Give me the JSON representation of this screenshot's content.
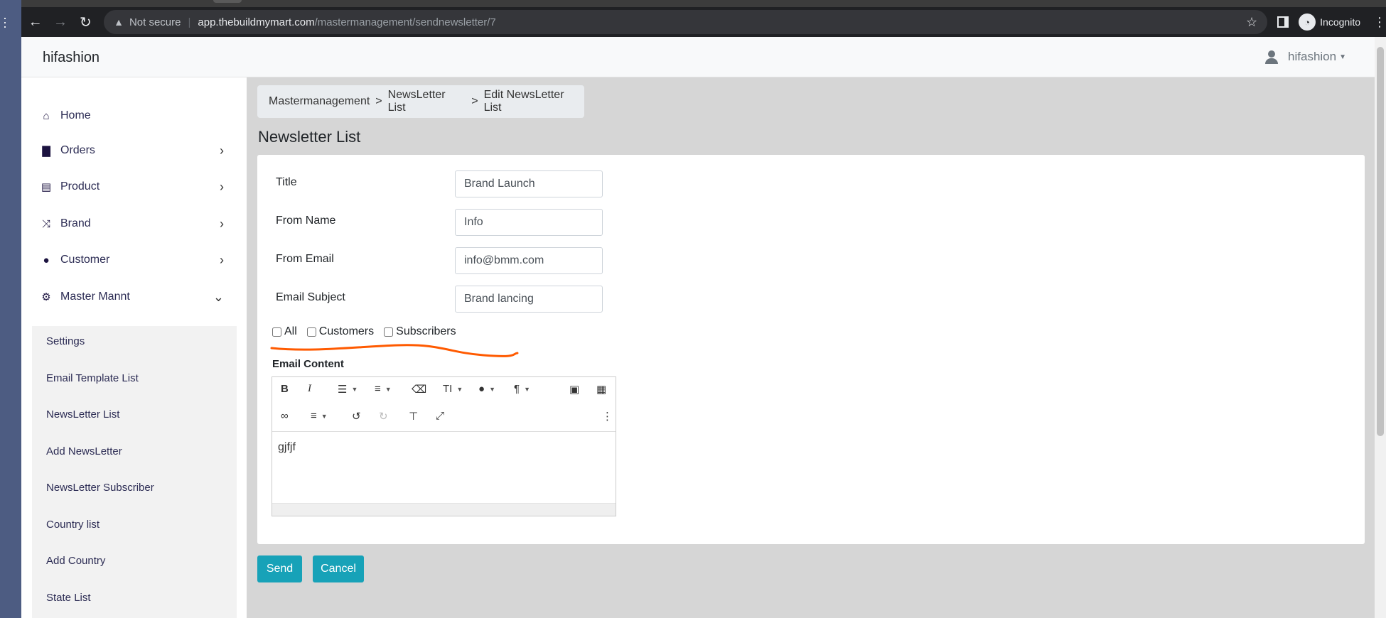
{
  "browser": {
    "security_label": "Not secure",
    "url_host": "app.thebuildmymart.com",
    "url_path": "/mastermanagement/sendnewsletter/7",
    "profile_label": "Incognito"
  },
  "navbar": {
    "brand": "hifashion",
    "user": "hifashion"
  },
  "sidebar": {
    "items": [
      {
        "label": "Home"
      },
      {
        "label": "Orders"
      },
      {
        "label": "Product"
      },
      {
        "label": "Brand"
      },
      {
        "label": "Customer"
      },
      {
        "label": "Master Mannt"
      }
    ],
    "submenu": [
      {
        "label": "Settings"
      },
      {
        "label": "Email Template List"
      },
      {
        "label": "NewsLetter List"
      },
      {
        "label": "Add NewsLetter"
      },
      {
        "label": "NewsLetter Subscriber"
      },
      {
        "label": "Country list"
      },
      {
        "label": "Add Country"
      },
      {
        "label": "State List"
      }
    ]
  },
  "breadcrumb": {
    "items": [
      "Mastermanagement",
      "NewsLetter List",
      "Edit NewsLetter List"
    ],
    "separator": ">"
  },
  "page_title": "Newsletter List",
  "form": {
    "title_label": "Title",
    "title_value": "Brand Launch",
    "from_name_label": "From Name",
    "from_name_value": "Info",
    "from_email_label": "From Email",
    "from_email_value": "info@bmm.com",
    "subject_label": "Email Subject",
    "subject_value": "Brand lancing",
    "checkboxes": [
      {
        "label": "All",
        "checked": false
      },
      {
        "label": "Customers",
        "checked": false
      },
      {
        "label": "Subscribers",
        "checked": false
      }
    ],
    "content_label": "Email Content",
    "content_value": "gjfjf"
  },
  "editor_toolbar": {
    "bold": "B",
    "italic": "I",
    "font_size": "TI",
    "paragraph": "¶"
  },
  "buttons": {
    "send": "Send",
    "cancel": "Cancel"
  },
  "colors": {
    "accent": "#17a2b8",
    "annotation": "#ff5a00"
  }
}
